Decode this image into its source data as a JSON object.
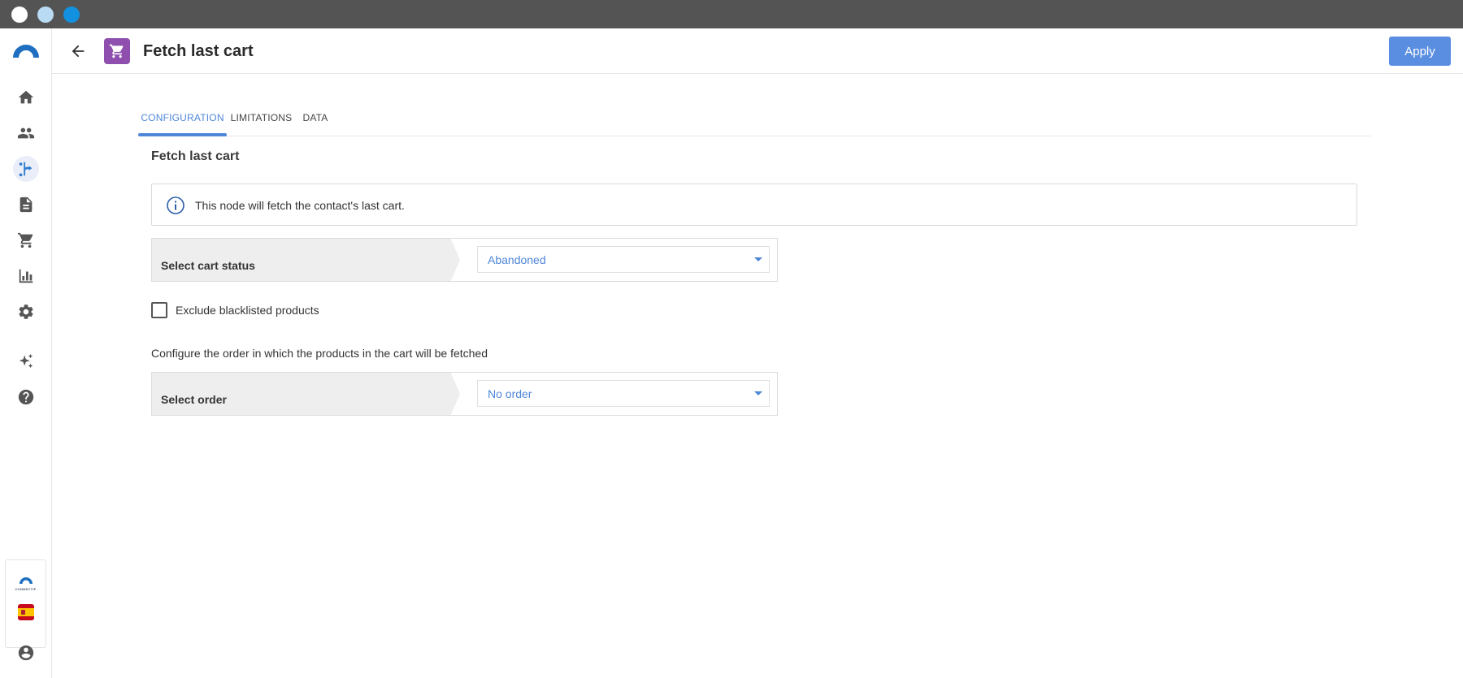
{
  "window": {
    "controls": [
      "close",
      "minimize",
      "maximize"
    ]
  },
  "rail": {
    "brand": "CONNECTIF",
    "items": [
      {
        "icon": "home-icon",
        "active": false
      },
      {
        "icon": "contacts-icon",
        "active": false
      },
      {
        "icon": "workflows-icon",
        "active": true
      },
      {
        "icon": "content-icon",
        "active": false
      },
      {
        "icon": "cart-icon",
        "active": false
      },
      {
        "icon": "analytics-icon",
        "active": false
      },
      {
        "icon": "settings-icon",
        "active": false
      },
      {
        "icon": "sparkles-icon",
        "active": false
      },
      {
        "icon": "help-icon",
        "active": false
      }
    ],
    "language_flag": "spain-flag-icon",
    "account_icon": "account-icon"
  },
  "header": {
    "title": "Fetch last cart",
    "node_icon": "cart-icon",
    "apply_label": "Apply"
  },
  "tabs": [
    {
      "label": "CONFIGURATION",
      "active": true
    },
    {
      "label": "LIMITATIONS",
      "active": false
    },
    {
      "label": "DATA",
      "active": false
    }
  ],
  "content": {
    "title": "Fetch last cart",
    "info_text": "This node will fetch the contact's last cart.",
    "cart_status": {
      "label": "Select cart status",
      "value": "Abandoned"
    },
    "exclude_blacklisted": {
      "label": "Exclude blacklisted products",
      "checked": false
    },
    "order_description": "Configure the order in which the products in the cart will be fetched",
    "order": {
      "label": "Select order",
      "value": "No order"
    }
  },
  "colors": {
    "accent": "#4e86d8",
    "apply_button": "#5a8ee0",
    "node_badge": "#8e4fae",
    "titlebar": "#545454"
  }
}
